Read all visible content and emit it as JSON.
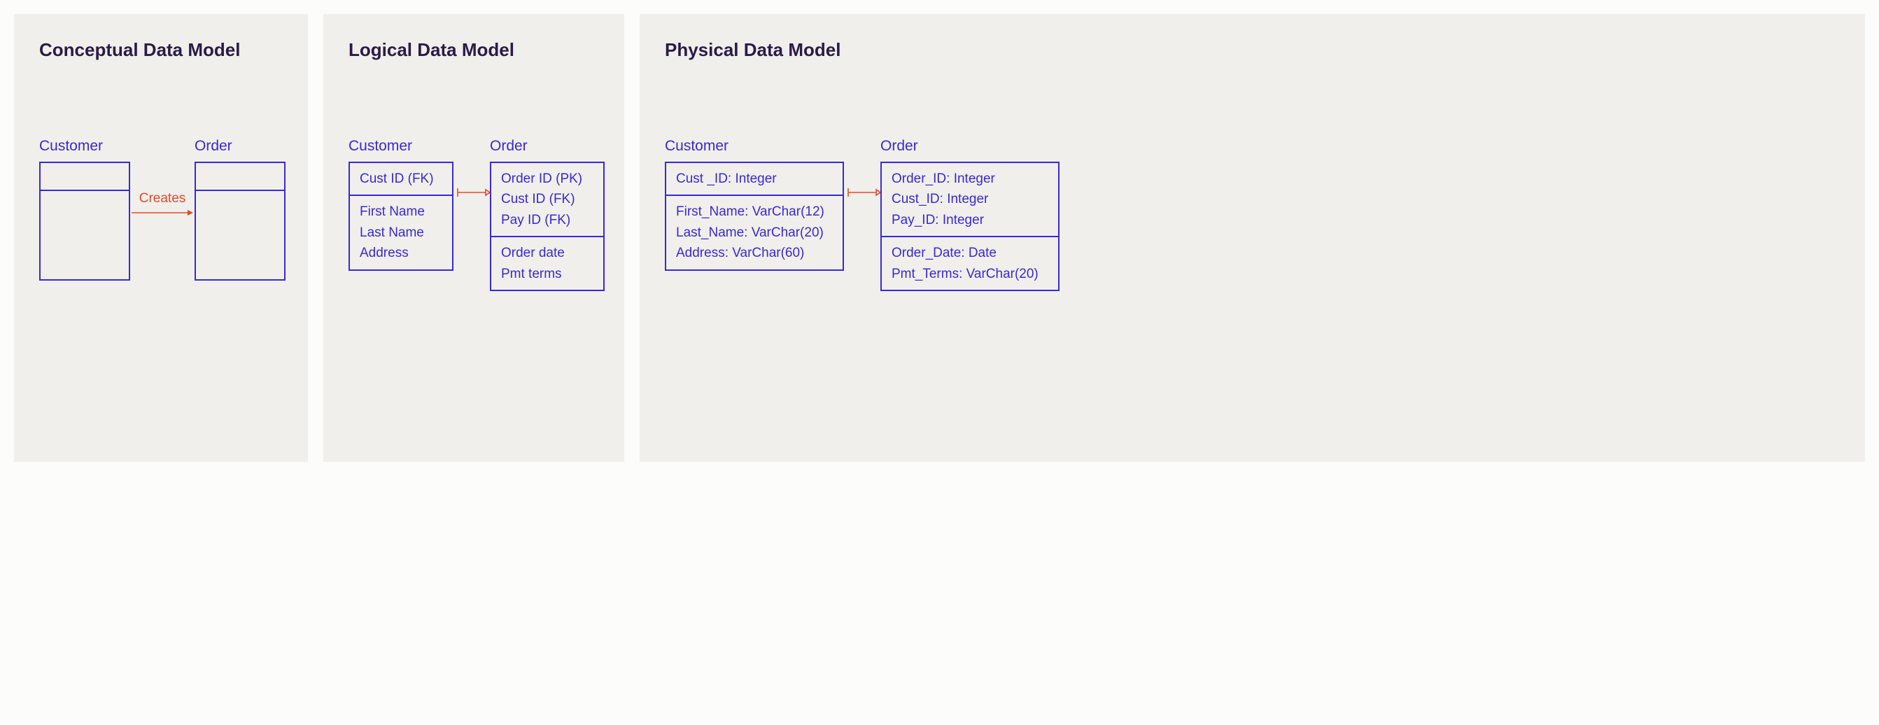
{
  "conceptual": {
    "title": "Conceptual Data Model",
    "customer_label": "Customer",
    "order_label": "Order",
    "relationship": "Creates"
  },
  "logical": {
    "title": "Logical Data Model",
    "customer_label": "Customer",
    "order_label": "Order",
    "customer": {
      "keys": [
        "Cust ID (FK)"
      ],
      "attrs": [
        "First Name",
        "Last Name",
        "Address"
      ]
    },
    "order": {
      "keys": [
        "Order ID (PK)",
        "Cust ID (FK)",
        "Pay ID (FK)"
      ],
      "attrs": [
        "Order date",
        "Pmt terms"
      ]
    }
  },
  "physical": {
    "title": "Physical Data Model",
    "customer_label": "Customer",
    "order_label": "Order",
    "customer": {
      "keys": [
        "Cust _ID: Integer"
      ],
      "attrs": [
        "First_Name: VarChar(12)",
        "Last_Name: VarChar(20)",
        "Address: VarChar(60)"
      ]
    },
    "order": {
      "keys": [
        "Order_ID: Integer",
        "Cust_ID: Integer",
        "Pay_ID: Integer"
      ],
      "attrs": [
        "Order_Date: Date",
        "Pmt_Terms: VarChar(20)"
      ]
    }
  }
}
